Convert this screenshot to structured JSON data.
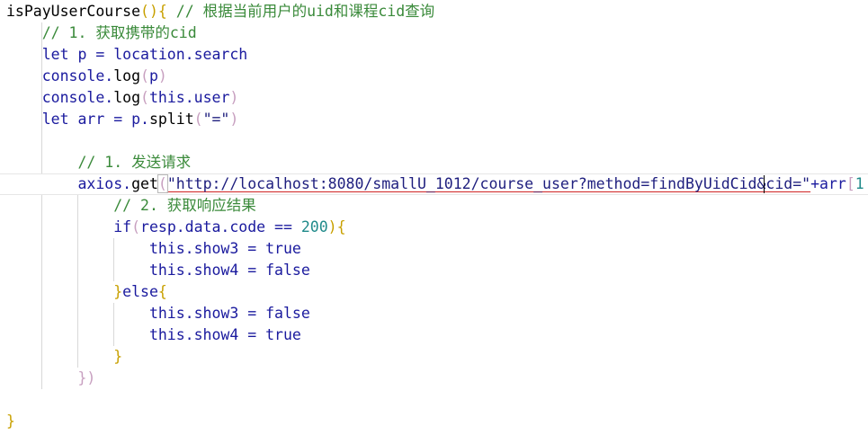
{
  "colors": {
    "plain": "#1a1a9e",
    "default": "#000000",
    "comment": "#3a8a3a",
    "string": "#1e1e7e",
    "number": "#1f8a8a",
    "bracket": "#c8a000",
    "brace_close": "#2c8c8c",
    "inner_paren": "#c8a0c0",
    "keyword": "#1a1a9e",
    "function_name": "#000000"
  },
  "lines": [
    {
      "tokens": [
        {
          "text": "isPayUserCourse",
          "color": "default"
        },
        {
          "text": "(){",
          "color": "bracket"
        },
        {
          "text": " // 根据当前用户的uid和课程cid查询",
          "color": "comment"
        }
      ]
    },
    {
      "tokens": [
        {
          "text": "    // 1. 获取携带的cid",
          "color": "comment"
        }
      ]
    },
    {
      "tokens": [
        {
          "text": "    let p = location.search",
          "color": "plain"
        }
      ]
    },
    {
      "tokens": [
        {
          "text": "    console.",
          "color": "plain"
        },
        {
          "text": "log",
          "color": "default"
        },
        {
          "text": "(",
          "color": "inner_paren"
        },
        {
          "text": "p",
          "color": "plain"
        },
        {
          "text": ")",
          "color": "inner_paren"
        }
      ]
    },
    {
      "tokens": [
        {
          "text": "    console.",
          "color": "plain"
        },
        {
          "text": "log",
          "color": "default"
        },
        {
          "text": "(",
          "color": "inner_paren"
        },
        {
          "text": "this.user",
          "color": "plain"
        },
        {
          "text": ")",
          "color": "inner_paren"
        }
      ]
    },
    {
      "tokens": [
        {
          "text": "    let arr = p.",
          "color": "plain"
        },
        {
          "text": "split",
          "color": "default"
        },
        {
          "text": "(",
          "color": "inner_paren"
        },
        {
          "text": "\"=\"",
          "color": "string"
        },
        {
          "text": ")",
          "color": "inner_paren"
        }
      ]
    },
    {
      "tokens": []
    },
    {
      "tokens": [
        {
          "text": "        // 1. 发送请求",
          "color": "comment"
        }
      ]
    },
    {
      "active": true,
      "tokens": [
        {
          "text": "        axios.",
          "color": "plain"
        },
        {
          "text": "get",
          "color": "default"
        },
        {
          "text": "(",
          "color": "inner_paren",
          "highlight": true
        },
        {
          "text": "\"http://localhost:8080/smallU_1012/course_user?method=findByUidCid&cid=\"",
          "color": "string",
          "squiggle": true
        },
        {
          "text": "+arr",
          "color": "plain"
        },
        {
          "text": "[",
          "color": "inner_paren"
        },
        {
          "text": "1",
          "color": "number"
        }
      ]
    },
    {
      "tokens": [
        {
          "text": "            // 2. 获取响应结果",
          "color": "comment"
        }
      ]
    },
    {
      "tokens": [
        {
          "text": "            if",
          "color": "plain"
        },
        {
          "text": "(",
          "color": "inner_paren"
        },
        {
          "text": "resp.data.code == ",
          "color": "plain"
        },
        {
          "text": "200",
          "color": "number"
        },
        {
          "text": "){",
          "color": "bracket"
        }
      ]
    },
    {
      "tokens": [
        {
          "text": "                this.show3 = true",
          "color": "plain"
        }
      ]
    },
    {
      "tokens": [
        {
          "text": "                this.show4 = false",
          "color": "plain"
        }
      ]
    },
    {
      "tokens": [
        {
          "text": "            }",
          "color": "bracket"
        },
        {
          "text": "else",
          "color": "plain"
        },
        {
          "text": "{",
          "color": "bracket"
        }
      ]
    },
    {
      "tokens": [
        {
          "text": "                this.show3 = false",
          "color": "plain"
        }
      ]
    },
    {
      "tokens": [
        {
          "text": "                this.show4 = true",
          "color": "plain"
        }
      ]
    },
    {
      "tokens": [
        {
          "text": "            }",
          "color": "bracket"
        }
      ]
    },
    {
      "tokens": [
        {
          "text": "        })",
          "color": "inner_paren"
        }
      ]
    },
    {
      "tokens": []
    },
    {
      "tokens": [
        {
          "text": "}",
          "color": "bracket"
        }
      ]
    }
  ]
}
